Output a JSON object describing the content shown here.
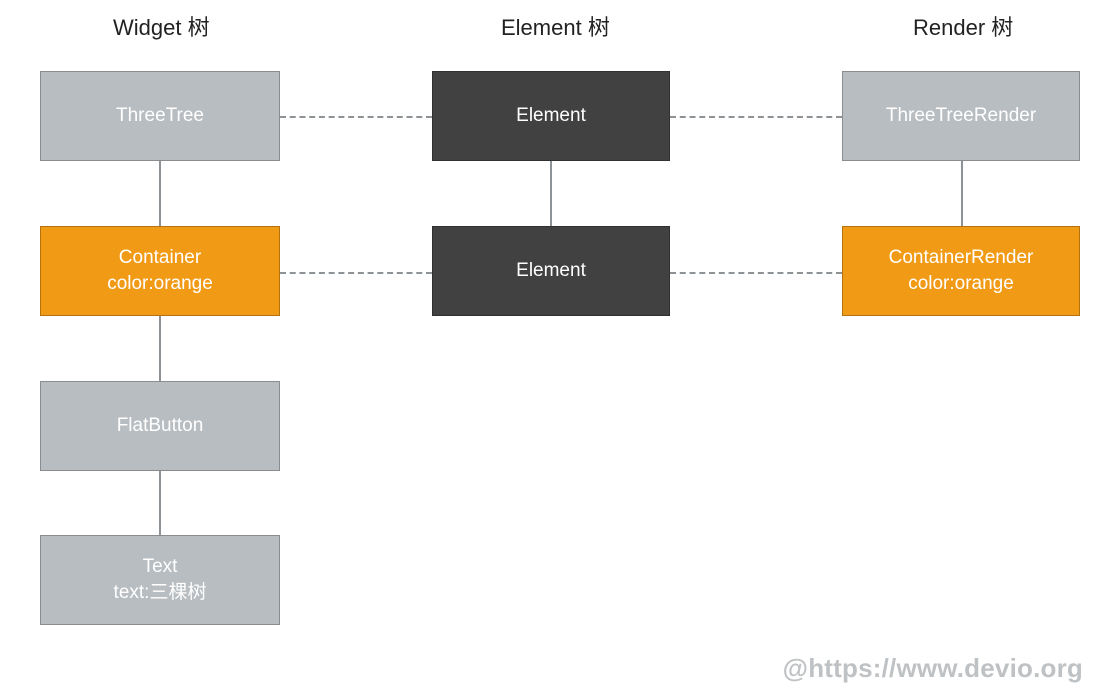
{
  "columns": {
    "widget": {
      "title": "Widget 树",
      "nodes": [
        {
          "lines": [
            "ThreeTree"
          ],
          "color": "gray"
        },
        {
          "lines": [
            "Container",
            "color:orange"
          ],
          "color": "orange"
        },
        {
          "lines": [
            "FlatButton"
          ],
          "color": "gray"
        },
        {
          "lines": [
            "Text",
            "text:三棵树"
          ],
          "color": "gray"
        }
      ]
    },
    "element": {
      "title": "Element 树",
      "nodes": [
        {
          "lines": [
            "Element"
          ],
          "color": "dark"
        },
        {
          "lines": [
            "Element"
          ],
          "color": "dark"
        }
      ]
    },
    "render": {
      "title": "Render 树",
      "nodes": [
        {
          "lines": [
            "ThreeTreeRender"
          ],
          "color": "gray"
        },
        {
          "lines": [
            "ContainerRender",
            "color:orange"
          ],
          "color": "orange"
        }
      ]
    }
  },
  "palette": {
    "gray": "#b8bdc1",
    "dark": "#414141",
    "orange": "#f19a15",
    "connector": "#8c9296"
  },
  "watermark": "@https://www.devio.org"
}
